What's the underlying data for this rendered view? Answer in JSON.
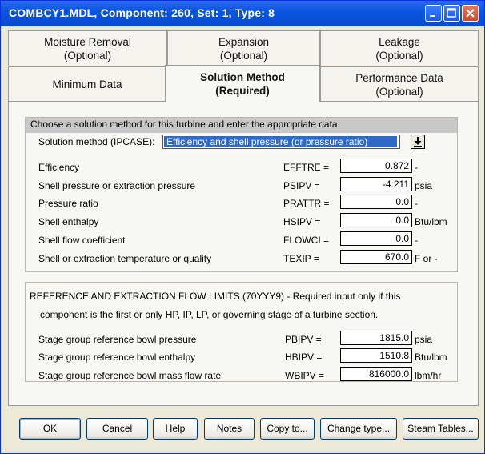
{
  "window": {
    "title": "COMBCY1.MDL,   Component: 260,   Set: 1,   Type: 8"
  },
  "tabs_top": [
    {
      "line1": "Moisture Removal",
      "line2": "(Optional)"
    },
    {
      "line1": "Expansion",
      "line2": "(Optional)"
    },
    {
      "line1": "Leakage",
      "line2": "(Optional)"
    }
  ],
  "tabs_bottom": [
    {
      "line1": "Minimum Data",
      "line2": ""
    },
    {
      "line1": "Solution Method",
      "line2": "(Required)"
    },
    {
      "line1": "Performance Data",
      "line2": "(Optional)"
    }
  ],
  "solution": {
    "header": "Choose a solution method for this turbine and enter the appropriate data:",
    "method_label": "Solution method (IPCASE):",
    "method_value": "Efficiency and shell pressure (or pressure ratio)",
    "fields": [
      {
        "label": "Efficiency",
        "code": "EFFTRE =",
        "value": "0.872",
        "unit": "-"
      },
      {
        "label": "Shell pressure or extraction pressure",
        "code": "PSIPV =",
        "value": "-4.211",
        "unit": "psia"
      },
      {
        "label": "Pressure ratio",
        "code": "PRATTR =",
        "value": "0.0",
        "unit": "-"
      },
      {
        "label": "Shell enthalpy",
        "code": "HSIPV =",
        "value": "0.0",
        "unit": "Btu/lbm"
      },
      {
        "label": "Shell flow coefficient",
        "code": "FLOWCI =",
        "value": "0.0",
        "unit": "-"
      },
      {
        "label": "Shell or extraction temperature or quality",
        "code": "TEXIP =",
        "value": "670.0",
        "unit": "F or -"
      }
    ]
  },
  "reference": {
    "header_line1": "REFERENCE AND EXTRACTION FLOW LIMITS (70YYY9) - Required input only if this",
    "header_line2": "component is the first or only HP, IP, LP, or governing stage of a turbine section.",
    "fields": [
      {
        "label": "Stage group reference bowl pressure",
        "code": "PBIPV =",
        "value": "1815.0",
        "unit": "psia"
      },
      {
        "label": "Stage group reference bowl enthalpy",
        "code": "HBIPV =",
        "value": "1510.8",
        "unit": "Btu/lbm"
      },
      {
        "label": "Stage group reference bowl mass flow rate",
        "code": "WBIPV =",
        "value": "816000.0",
        "unit": "lbm/hr"
      }
    ]
  },
  "buttons": {
    "ok": "OK",
    "cancel": "Cancel",
    "help": "Help",
    "notes": "Notes",
    "copy": "Copy to...",
    "change_type": "Change type...",
    "steam_tables": "Steam Tables..."
  },
  "colors": {
    "titlebar": "#0a55e0",
    "selection": "#3169c6",
    "face": "#ece9d8"
  }
}
